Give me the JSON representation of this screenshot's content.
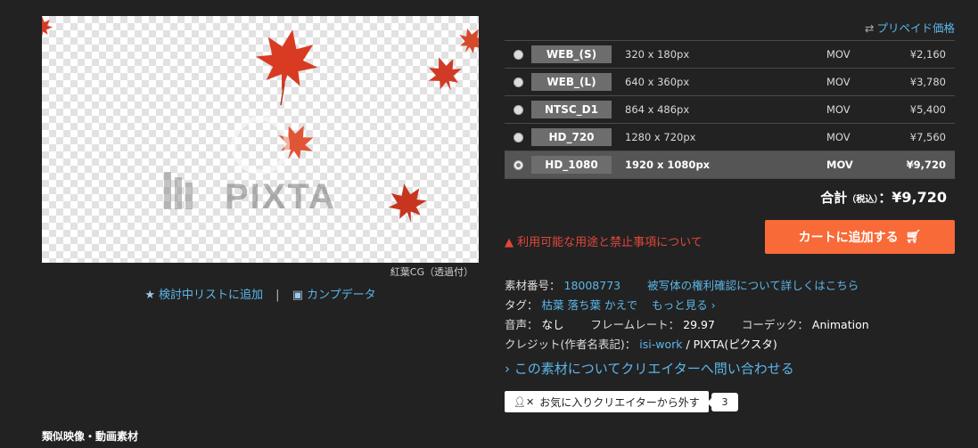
{
  "preview": {
    "watermark_text": "PIXTA",
    "caption": "紅葉CG（透過付）"
  },
  "under_preview": {
    "watchlist_icon": "star-icon",
    "watchlist_label": "検討中リストに追加",
    "separator": "|",
    "comp_icon": "image-icon",
    "comp_label": "カンプデータ"
  },
  "prepaid": {
    "icon": "swap-icon",
    "label": "プリペイド価格"
  },
  "options": [
    {
      "name": "WEB_(S)",
      "resolution": "320 x 180px",
      "format": "MOV",
      "price": "¥2,160",
      "selected": false
    },
    {
      "name": "WEB_(L)",
      "resolution": "640 x 360px",
      "format": "MOV",
      "price": "¥3,780",
      "selected": false
    },
    {
      "name": "NTSC_D1",
      "resolution": "864 x 486px",
      "format": "MOV",
      "price": "¥5,400",
      "selected": false
    },
    {
      "name": "HD_720",
      "resolution": "1280 x 720px",
      "format": "MOV",
      "price": "¥7,560",
      "selected": false
    },
    {
      "name": "HD_1080",
      "resolution": "1920 x 1080px",
      "format": "MOV",
      "price": "¥9,720",
      "selected": true
    }
  ],
  "total": {
    "label": "合計",
    "tax": "（税込）",
    "colon": "：",
    "value": "¥9,720"
  },
  "warning": {
    "icon": "warning-icon",
    "text": "利用可能な用途と禁止事項について"
  },
  "cart": {
    "label": "カートに追加する",
    "icon": "cart-icon"
  },
  "info": {
    "material_label": "素材番号：",
    "material_id": "18008773",
    "rights_link": "被写体の権利確認について詳しくはこちら",
    "tags_label": "タグ：",
    "tags": [
      "枯葉",
      "落ち葉",
      "かえで"
    ],
    "more_label": "もっと見る ›",
    "audio_label": "音声：",
    "audio_value": "なし",
    "framerate_label": "フレームレート：",
    "framerate_value": "29.97",
    "codec_label": "コーデック：",
    "codec_value": "Animation",
    "credit_label": "クレジット(作者名表記)：",
    "credit_author": "isi-work",
    "credit_suffix": "/ PIXTA(ピクスタ)"
  },
  "contact": {
    "chevron": "›",
    "label": "この素材についてクリエイターへ問い合わせる"
  },
  "favorite": {
    "icon": "user-remove-icon",
    "label": "お気に入りクリエイターから外す",
    "count": "3"
  },
  "similar_heading": "類似映像・動画素材",
  "colors": {
    "background": "#222222",
    "accent": "#f86a38",
    "link": "#5cb6ea",
    "warning": "#e2473a"
  }
}
